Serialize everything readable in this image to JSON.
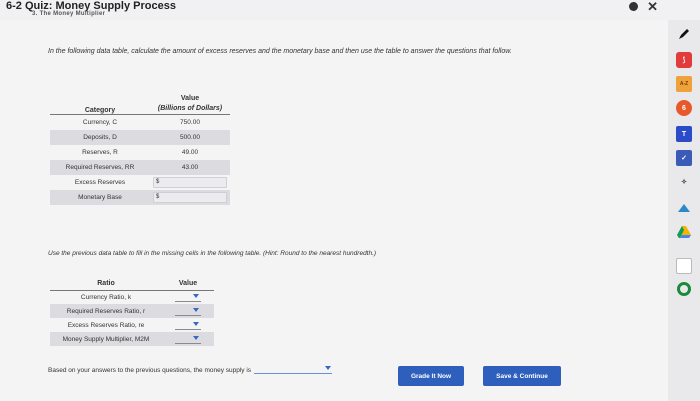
{
  "window": {
    "title": "6-2 Quiz: Money Supply Process",
    "subtitle": "3. The Money Multiplier"
  },
  "instructions": "In the following data table, calculate the amount of excess reserves and the monetary base and then use the table to answer the questions that follow.",
  "data_table": {
    "header_category": "Category",
    "header_value": "Value",
    "header_units": "(Billions of Dollars)",
    "rows": [
      {
        "category": "Currency, C",
        "value": "750.00"
      },
      {
        "category": "Deposits, D",
        "value": "500.00"
      },
      {
        "category": "Reserves, R",
        "value": "49.00"
      },
      {
        "category": "Required Reserves, RR",
        "value": "43.00"
      },
      {
        "category": "Excess Reserves",
        "value": "$"
      },
      {
        "category": "Monetary Base",
        "value": "$"
      }
    ]
  },
  "instructions2": "Use the previous data table to fill in the missing cells in the following table. (Hint: Round to the nearest hundredth.)",
  "ratio_table": {
    "header_ratio": "Ratio",
    "header_value": "Value",
    "rows": [
      {
        "label": "Currency Ratio, k"
      },
      {
        "label": "Required Reserves Ratio, r"
      },
      {
        "label": "Excess Reserves Ratio, re"
      },
      {
        "label": "Money Supply Multiplier, M2M"
      }
    ]
  },
  "answer_prompt": "Based on your answers to the previous questions, the money supply is",
  "buttons": {
    "grade": "Grade It Now",
    "save": "Save & Continue"
  },
  "sidebar_icons": [
    "app-red",
    "a-z",
    "orange-circle",
    "t",
    "check",
    "wifi",
    "bookmark",
    "drive",
    "square",
    "circle"
  ]
}
